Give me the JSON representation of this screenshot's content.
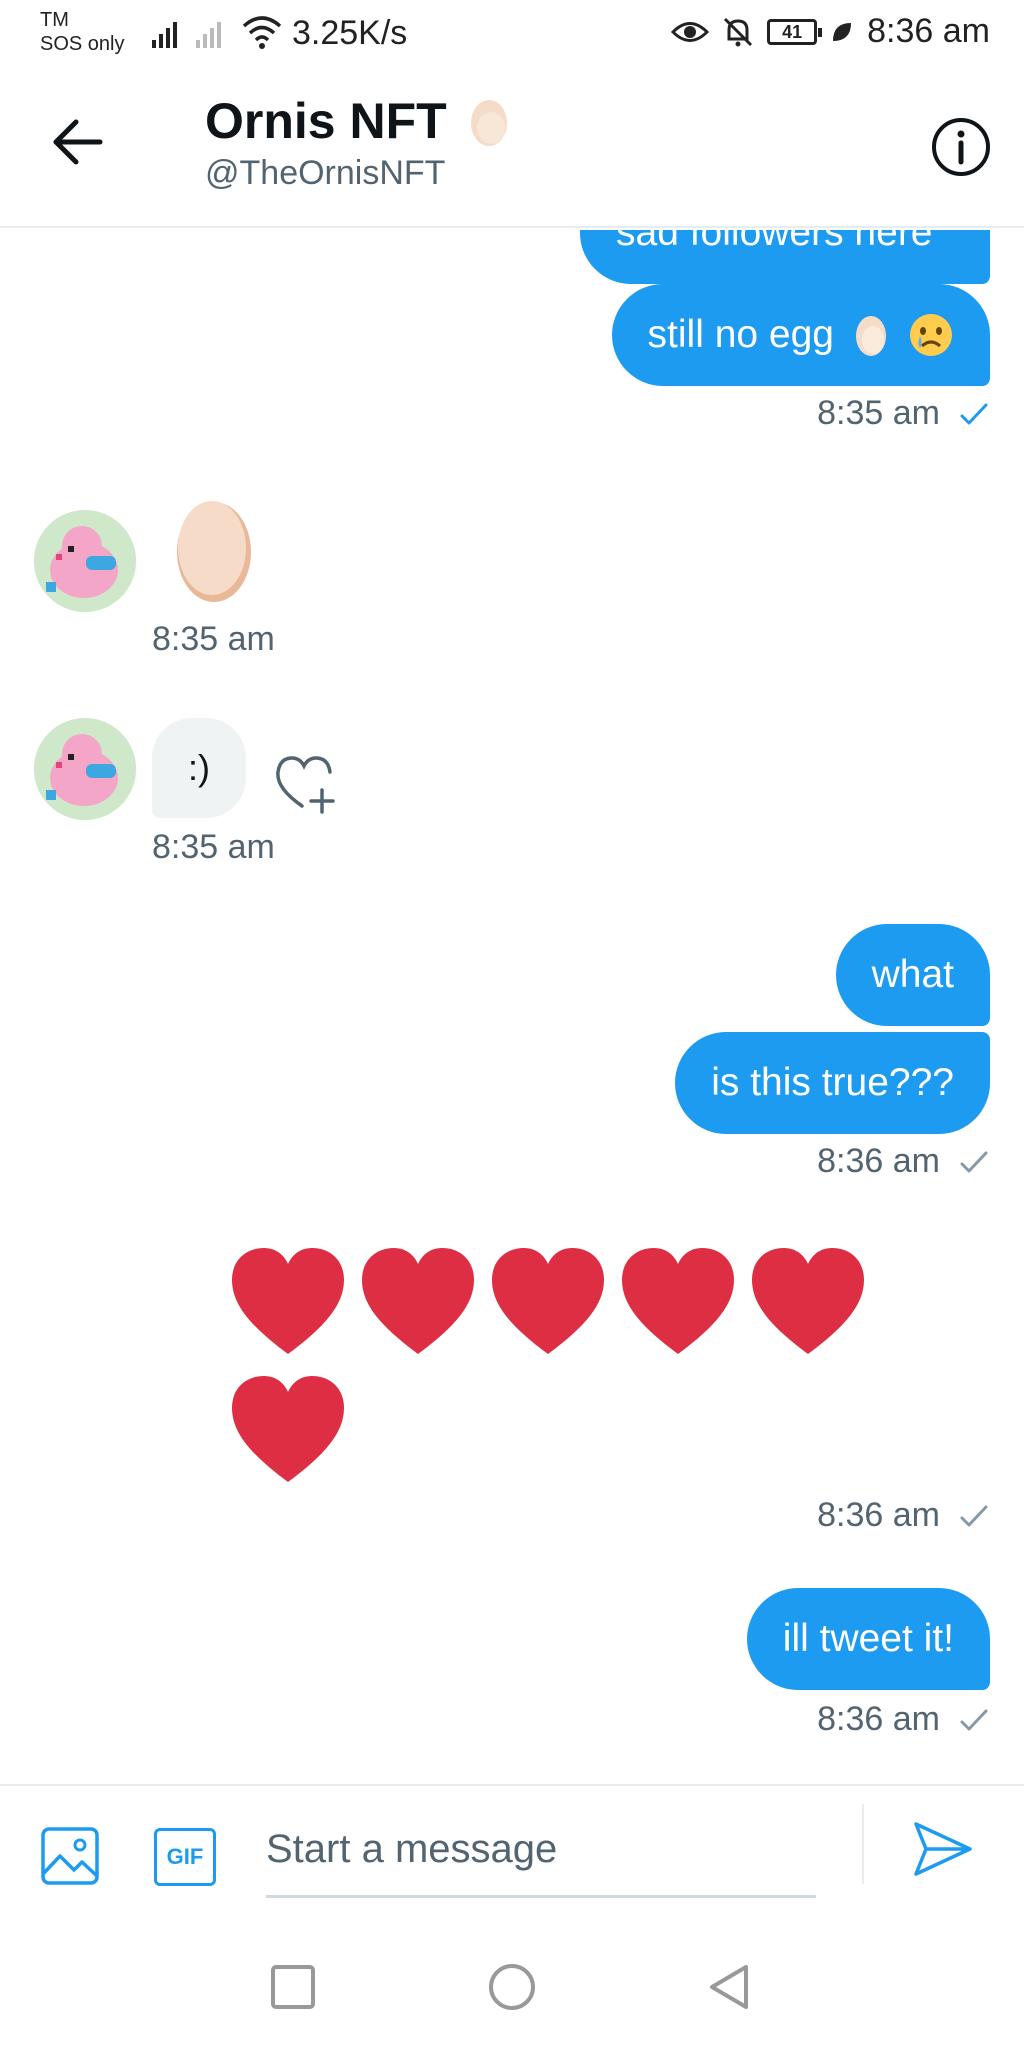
{
  "status_bar": {
    "carrier_line1": "TM",
    "carrier_line2": "SOS only",
    "net_speed": "3.25K/s",
    "battery": "41",
    "time": "8:36 am"
  },
  "header": {
    "title": "Ornis NFT",
    "handle": "@TheOrnisNFT"
  },
  "messages": {
    "partial_text": "sad followers here",
    "m1_text": "still no egg",
    "m1_time": "8:35 am",
    "in1_time": "8:35 am",
    "in2_text": ":)",
    "in2_time": "8:35 am",
    "m2_text": "what",
    "m3_text": "is this true???",
    "m3_time": "8:36 am",
    "hearts_count": 6,
    "hearts_time": "8:36 am",
    "m4_text": "ill tweet it!",
    "m4_time": "8:36 am"
  },
  "composer": {
    "gif_label": "GIF",
    "placeholder": "Start a message"
  },
  "colors": {
    "accent": "#1d9bf0",
    "heart": "#dd2e44",
    "bubble_in": "#eff3f4",
    "muted_text": "#536471"
  }
}
